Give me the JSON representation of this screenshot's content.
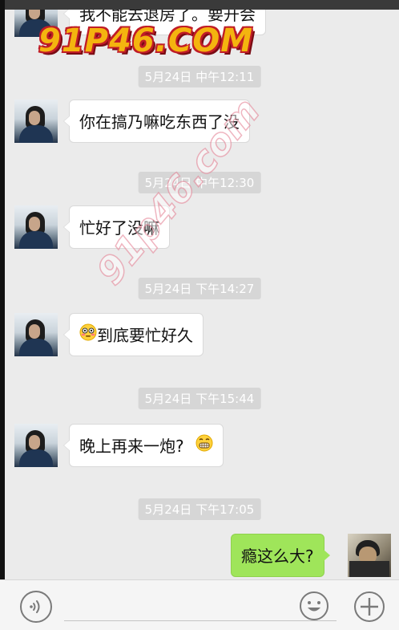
{
  "watermark": {
    "logo_text": "91P46.COM",
    "diagonal_text": "91p46.com"
  },
  "messages": [
    {
      "type": "in",
      "text": "我不能去退房了。要开会"
    },
    {
      "type": "time",
      "text": "5月24日 中午12:11"
    },
    {
      "type": "in",
      "text": "你在搞乃嘛吃东西了没"
    },
    {
      "type": "time",
      "text": "5月24日 中午12:30"
    },
    {
      "type": "in",
      "text": "忙好了没嘛"
    },
    {
      "type": "time",
      "text": "5月24日 下午14:27"
    },
    {
      "type": "in",
      "text": "到底要忙好久",
      "emoji": "flushed-face-emoji"
    },
    {
      "type": "time",
      "text": "5月24日 下午15:44"
    },
    {
      "type": "in",
      "text": "晚上再来一炮?",
      "emoji": "grimacing-face-emoji"
    },
    {
      "type": "time",
      "text": "5月24日 下午17:05"
    },
    {
      "type": "out",
      "text": "瘾这么大?"
    }
  ],
  "input_bar": {
    "voice_icon": "voice-icon",
    "emoji_icon": "emoji-icon",
    "add_icon": "plus-icon",
    "input_value": ""
  }
}
